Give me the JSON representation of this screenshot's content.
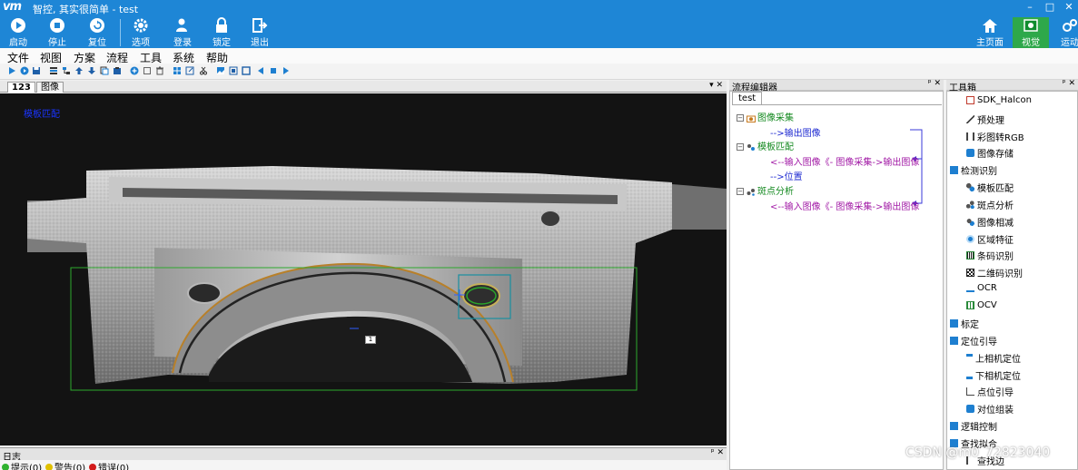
{
  "window": {
    "title": "智控, 其实很简单 - test",
    "logo": "vm",
    "controls": [
      "–",
      "□",
      "✕"
    ]
  },
  "ribbon": {
    "left_buttons": [
      {
        "label": "启动",
        "icon": "play-icon"
      },
      {
        "label": "停止",
        "icon": "stop-icon"
      },
      {
        "label": "复位",
        "icon": "reset-icon"
      },
      {
        "label": "选项",
        "icon": "gear-icon"
      },
      {
        "label": "登录",
        "icon": "user-icon"
      },
      {
        "label": "锁定",
        "icon": "lock-icon"
      },
      {
        "label": "退出",
        "icon": "exit-icon"
      }
    ],
    "right_buttons": [
      {
        "label": "主页面",
        "icon": "home-icon"
      },
      {
        "label": "视觉",
        "icon": "vision-icon",
        "active": true
      },
      {
        "label": "运动",
        "icon": "motion-icon"
      }
    ]
  },
  "menu": [
    "文件",
    "视图",
    "方案",
    "流程",
    "工具",
    "系统",
    "帮助"
  ],
  "toolbar_icons": [
    "run-icon",
    "run-once-icon",
    "save-icon",
    "list-icon",
    "tree-icon",
    "upload-icon",
    "download-icon",
    "copy-icon",
    "paste-icon",
    "plus-circle-icon",
    "duplicate-icon",
    "delete-icon",
    "grid-icon",
    "export-icon",
    "scissors-icon",
    "image-icon",
    "image-view-icon",
    "window-icon",
    "prev-icon",
    "stop-small-icon",
    "next-icon"
  ],
  "document": {
    "tabs": [
      "123",
      "图像"
    ],
    "active_tab": "123",
    "controls": "▾ ✕",
    "overlay_text": "模板匹配",
    "roi_label": "1"
  },
  "log": {
    "title": "日志",
    "controls": "ᵖ ✕",
    "statuses": [
      {
        "label": "提示(0)",
        "color": "#2fb12f"
      },
      {
        "label": "警告(0)",
        "color": "#e0c000"
      },
      {
        "label": "错误(0)",
        "color": "#d21b1b"
      }
    ]
  },
  "flow_editor": {
    "title": "流程编辑器",
    "controls": "ᵖ ✕",
    "tab": "test",
    "nodes": [
      {
        "name": "图像采集",
        "params": [
          {
            "text": "-->输出图像",
            "kind": "output"
          }
        ]
      },
      {
        "name": "模板匹配",
        "params": [
          {
            "text": "<--输入图像《- 图像采集->输出图像",
            "kind": "input"
          },
          {
            "text": "-->位置",
            "kind": "output"
          }
        ]
      },
      {
        "name": "斑点分析",
        "params": [
          {
            "text": "<--输入图像《- 图像采集->输出图像",
            "kind": "input"
          }
        ]
      }
    ]
  },
  "toolbox": {
    "title": "工具箱",
    "controls": "ᵖ ✕",
    "items": [
      {
        "label": "SDK_Halcon",
        "level": 1,
        "icon": "halcon-icon"
      },
      {
        "label": "预处理",
        "level": 1,
        "icon": "wand-icon"
      },
      {
        "label": "彩图转RGB",
        "level": 1,
        "icon": "rgb-icon"
      },
      {
        "label": "图像存储",
        "level": 1,
        "icon": "storage-icon"
      },
      {
        "label": "检测识别",
        "level": 0,
        "icon": "category-icon"
      },
      {
        "label": "模板匹配",
        "level": 1,
        "icon": "template-icon"
      },
      {
        "label": "斑点分析",
        "level": 1,
        "icon": "blob-icon"
      },
      {
        "label": "图像相减",
        "level": 1,
        "icon": "subtract-icon"
      },
      {
        "label": "区域特征",
        "level": 1,
        "icon": "region-icon"
      },
      {
        "label": "条码识别",
        "level": 1,
        "icon": "barcode-icon"
      },
      {
        "label": "二维码识别",
        "level": 1,
        "icon": "qrcode-icon"
      },
      {
        "label": "OCR",
        "level": 1,
        "icon": "ocr-icon"
      },
      {
        "label": "OCV",
        "level": 1,
        "icon": "ocv-icon"
      },
      {
        "label": "标定",
        "level": 0,
        "icon": "category-icon"
      },
      {
        "label": "定位引导",
        "level": 0,
        "icon": "category-icon"
      },
      {
        "label": "上相机定位",
        "level": 1,
        "icon": "camera-up-icon"
      },
      {
        "label": "下相机定位",
        "level": 1,
        "icon": "camera-down-icon"
      },
      {
        "label": "点位引导",
        "level": 1,
        "icon": "point-guide-icon"
      },
      {
        "label": "对位组装",
        "level": 1,
        "icon": "assembly-icon"
      },
      {
        "label": "逻辑控制",
        "level": 0,
        "icon": "category-icon"
      },
      {
        "label": "查找拟合",
        "level": 0,
        "icon": "category-icon"
      },
      {
        "label": "查找边",
        "level": 1,
        "icon": "edge-icon"
      }
    ]
  },
  "watermark": "CSDN @m0_72823040"
}
